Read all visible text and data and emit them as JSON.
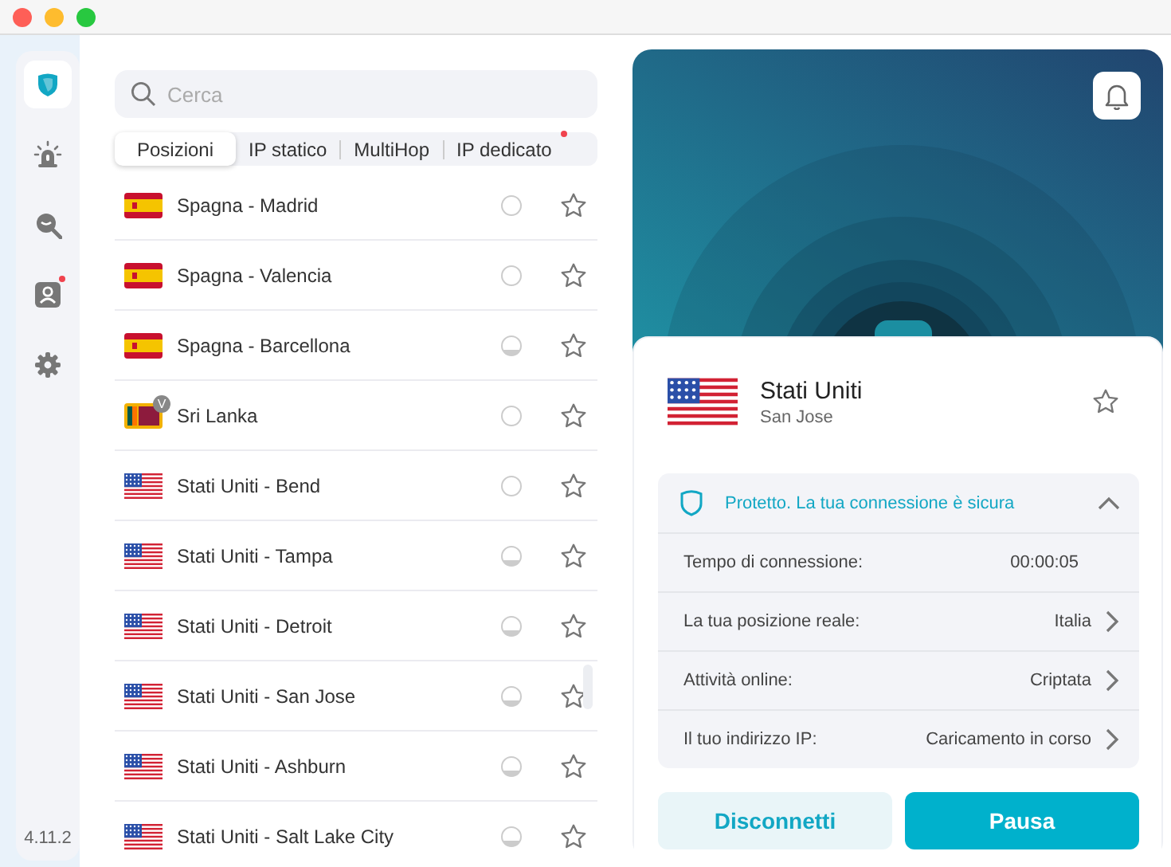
{
  "sidebar": {
    "items": [
      {
        "kind": "shield",
        "selected": true,
        "dot": false
      },
      {
        "kind": "alarm",
        "selected": false,
        "dot": false
      },
      {
        "kind": "zoom",
        "selected": false,
        "dot": false
      },
      {
        "kind": "account",
        "selected": false,
        "dot": true
      },
      {
        "kind": "gear",
        "selected": false,
        "dot": false
      }
    ],
    "version": "4.11.2"
  },
  "search": {
    "placeholder": "Cerca"
  },
  "tabs": [
    {
      "label": "Posizioni",
      "selected": true,
      "dot": false
    },
    {
      "label": "IP statico",
      "selected": false,
      "dot": false
    },
    {
      "label": "MultiHop",
      "selected": false,
      "dot": false
    },
    {
      "label": "IP dedicato",
      "selected": false,
      "dot": true
    }
  ],
  "locations": [
    {
      "kind": "spain",
      "name": "Spagna - Madrid",
      "busy": false
    },
    {
      "kind": "spain",
      "name": "Spagna - Valencia",
      "busy": false
    },
    {
      "kind": "spain",
      "name": "Spagna - Barcellona",
      "busy": true
    },
    {
      "kind": "srilanka",
      "name": "Sri Lanka",
      "busy": false,
      "badge": "V"
    },
    {
      "kind": "usa",
      "name": "Stati Uniti - Bend",
      "busy": false
    },
    {
      "kind": "usa",
      "name": "Stati Uniti - Tampa",
      "busy": true
    },
    {
      "kind": "usa",
      "name": "Stati Uniti - Detroit",
      "busy": true
    },
    {
      "kind": "usa",
      "name": "Stati Uniti - San Jose",
      "busy": true
    },
    {
      "kind": "usa",
      "name": "Stati Uniti - Ashburn",
      "busy": true
    },
    {
      "kind": "usa",
      "name": "Stati Uniti - Salt Lake City",
      "busy": true
    }
  ],
  "connection": {
    "kind": "usa",
    "country": "Stati Uniti",
    "city": "San Jose",
    "status": "Protetto. La tua connessione è sicura",
    "expanded": true,
    "details": [
      {
        "label": "Tempo di connessione:",
        "value": "00:00:05",
        "link": false
      },
      {
        "label": "La tua posizione reale:",
        "value": "Italia",
        "link": true
      },
      {
        "label": "Attività online:",
        "value": "Criptata",
        "link": true
      },
      {
        "label": "Il tuo indirizzo IP:",
        "value": "Caricamento in corso",
        "link": true
      }
    ],
    "buttons": [
      {
        "label": "Disconnetti",
        "kind": "secondary"
      },
      {
        "label": "Pausa",
        "kind": "primary"
      }
    ]
  }
}
